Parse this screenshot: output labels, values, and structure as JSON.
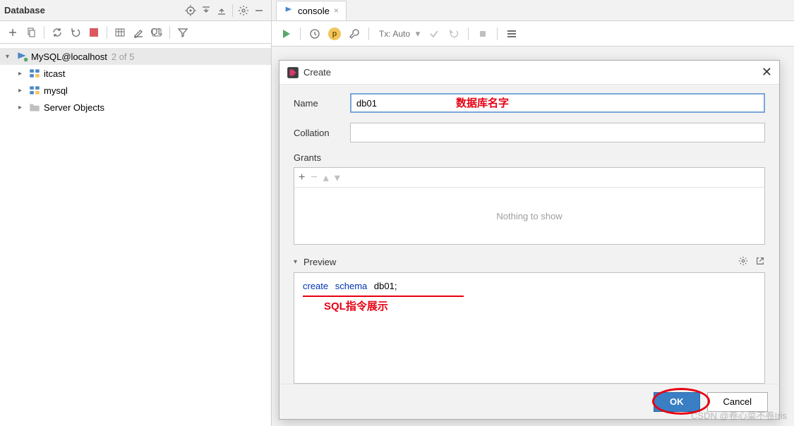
{
  "sidebar": {
    "title": "Database",
    "root": {
      "label": "MySQL@localhost",
      "meta": "2 of 5"
    },
    "children": [
      {
        "label": "itcast"
      },
      {
        "label": "mysql"
      },
      {
        "label": "Server Objects"
      }
    ]
  },
  "tab": {
    "label": "console"
  },
  "console_toolbar": {
    "tx_label": "Tx: Auto"
  },
  "dialog": {
    "title": "Create",
    "name_label": "Name",
    "name_value": "db01",
    "name_annotation": "数据库名字",
    "collation_label": "Collation",
    "collation_value": "",
    "grants_label": "Grants",
    "grants_empty": "Nothing to show",
    "preview_label": "Preview",
    "sql": {
      "kw1": "create",
      "kw2": "schema",
      "ident": "db01",
      "tail": ";"
    },
    "sql_annotation": "SQL指令展示",
    "ok": "OK",
    "cancel": "Cancel"
  },
  "watermark": "CSDN @卷心菜不卷Iris"
}
